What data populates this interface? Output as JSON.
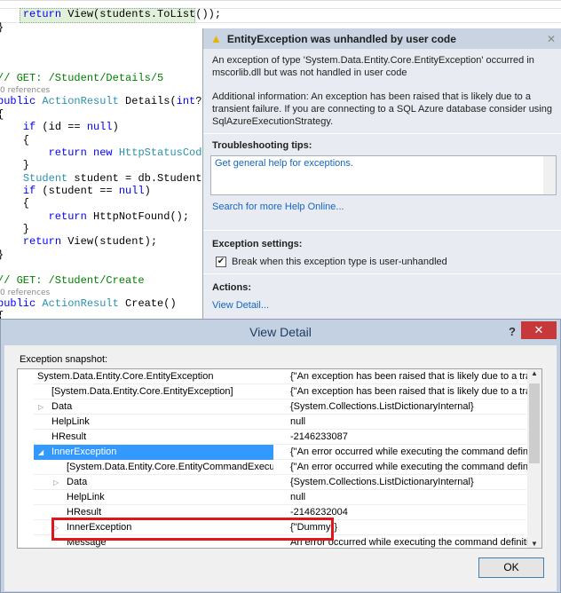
{
  "code": {
    "lines": [
      {
        "t": "    return View(students.ToList());",
        "c": ""
      },
      {
        "t": "}",
        "c": ""
      },
      {
        "t": "// GET: /Student/Details/5",
        "c": "cm"
      },
      {
        "t": "0 references",
        "c": "refs"
      },
      {
        "t": "public ActionResult Details(int? id)",
        "c": ""
      },
      {
        "t": "{",
        "c": ""
      },
      {
        "t": "    if (id == null)",
        "c": ""
      },
      {
        "t": "    {",
        "c": ""
      },
      {
        "t": "        return new HttpStatusCodeResu",
        "c": ""
      },
      {
        "t": "    }",
        "c": ""
      },
      {
        "t": "    Student student = db.Students.Fir",
        "c": ""
      },
      {
        "t": "    if (student == null)",
        "c": ""
      },
      {
        "t": "    {",
        "c": ""
      },
      {
        "t": "        return HttpNotFound();",
        "c": ""
      },
      {
        "t": "    }",
        "c": ""
      },
      {
        "t": "    return View(student);",
        "c": ""
      },
      {
        "t": "}",
        "c": ""
      },
      {
        "t": "// GET: /Student/Create",
        "c": "cm"
      },
      {
        "t": "0 references",
        "c": "refs"
      },
      {
        "t": "public ActionResult Create()",
        "c": ""
      },
      {
        "t": "{",
        "c": ""
      }
    ]
  },
  "popup": {
    "title": "EntityException was unhandled by user code",
    "warning_icon": "warning-triangle-icon",
    "message": "An exception of type 'System.Data.Entity.Core.EntityException' occurred in mscorlib.dll but was not handled in user code",
    "additional": "Additional information: An exception has been raised that is likely due to a transient failure. If you are connecting to a SQL Azure database consider using SqlAzureExecutionStrategy.",
    "tips_heading": "Troubleshooting tips:",
    "tip_link": "Get general help for exceptions.",
    "search_link": "Search for more Help Online...",
    "settings_heading": "Exception settings:",
    "break_checkbox": "Break when this exception type is user-unhandled",
    "break_checked": true,
    "actions_heading": "Actions:",
    "view_detail_link": "View Detail..."
  },
  "dialog": {
    "title": "View Detail",
    "help": "?",
    "close": "✕",
    "snapshot_label": "Exception snapshot:",
    "rows": [
      {
        "name": "System.Data.Entity.Core.EntityException",
        "value": "{\"An exception has been raised that is likely due to a transien",
        "level": 0,
        "exp": "open"
      },
      {
        "name": "[System.Data.Entity.Core.EntityException]",
        "value": "{\"An exception has been raised that is likely due to a transien",
        "level": 1,
        "exp": ""
      },
      {
        "name": "Data",
        "value": "{System.Collections.ListDictionaryInternal}",
        "level": 1,
        "exp": "closed"
      },
      {
        "name": "HelpLink",
        "value": "null",
        "level": 1,
        "exp": ""
      },
      {
        "name": "HResult",
        "value": "-2146233087",
        "level": 1,
        "exp": ""
      },
      {
        "name": "InnerException",
        "value": "{\"An error occurred while executing the command definition",
        "level": 1,
        "exp": "open",
        "selected": true
      },
      {
        "name": "[System.Data.Entity.Core.EntityCommandExecut",
        "value": "{\"An error occurred while executing the command definition",
        "level": 2,
        "exp": ""
      },
      {
        "name": "Data",
        "value": "{System.Collections.ListDictionaryInternal}",
        "level": 2,
        "exp": "closed"
      },
      {
        "name": "HelpLink",
        "value": "null",
        "level": 2,
        "exp": ""
      },
      {
        "name": "HResult",
        "value": "-2146232004",
        "level": 2,
        "exp": ""
      },
      {
        "name": "InnerException",
        "value": "{\"Dummy\"}",
        "level": 2,
        "exp": "closed"
      },
      {
        "name": "Message",
        "value": "An error occurred while executing the command definition. S",
        "level": 2,
        "exp": ""
      }
    ],
    "ok": "OK"
  }
}
